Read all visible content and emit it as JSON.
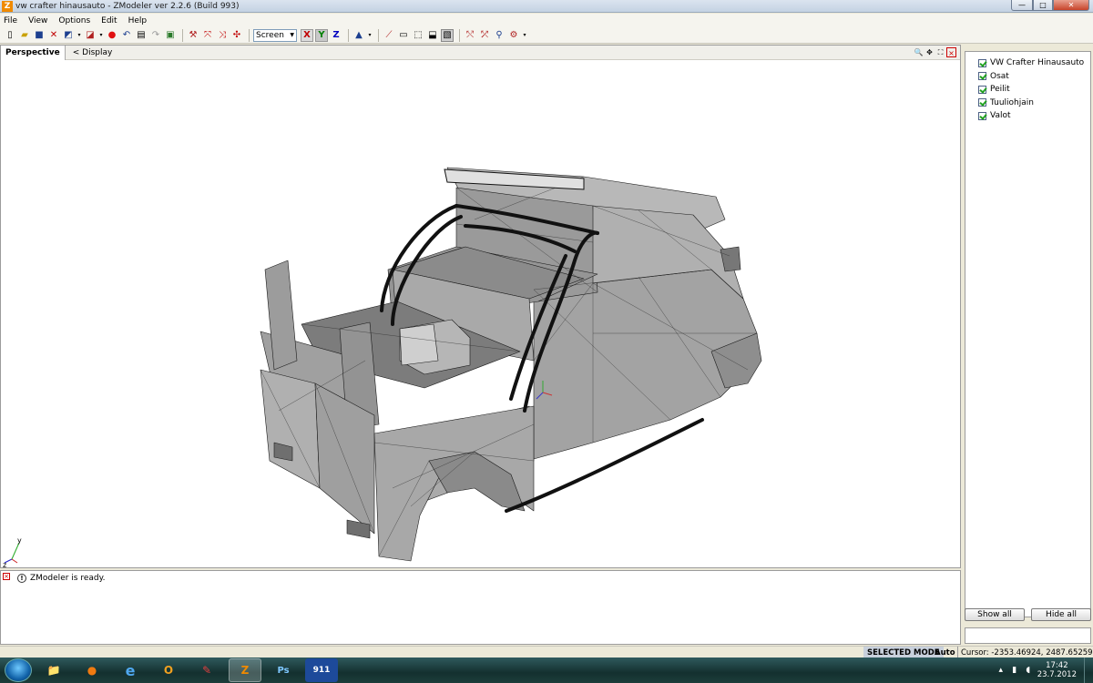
{
  "window": {
    "title": "vw crafter hinausauto - ZModeler ver 2.2.6 (Build 993)",
    "app_icon_letter": "Z",
    "minimize_glyph": "—",
    "maximize_glyph": "□",
    "close_glyph": "✕"
  },
  "menu": [
    "File",
    "View",
    "Options",
    "Edit",
    "Help"
  ],
  "toolbar": {
    "select_value": "Screen",
    "axes": [
      "X",
      "Y",
      "Z"
    ],
    "icons": [
      "new-icon",
      "open-icon",
      "save-icon",
      "delete-icon",
      "import-icon",
      "export-icon",
      "record-icon",
      "undo-icon",
      "properties-icon",
      "render-icon",
      "hierarchy-icon",
      "move-icon",
      "rotate-icon",
      "scale-icon",
      "pointer-icon",
      "pin-icon",
      "frame-icon",
      "box-icon",
      "cube-icon",
      "select-box-icon",
      "wireframe-icon",
      "weld-icon",
      "split-icon",
      "walk-icon",
      "gear-icon"
    ]
  },
  "viewport": {
    "tab": "Perspective",
    "display_label": "<  Display",
    "axis_labels": {
      "y": "y",
      "z": "z"
    }
  },
  "objects": [
    {
      "label": "VW Crafter Hinausauto",
      "checked": true
    },
    {
      "label": "Osat",
      "checked": true
    },
    {
      "label": "Peilit",
      "checked": true
    },
    {
      "label": "Tuuliohjain",
      "checked": true
    },
    {
      "label": "Valot",
      "checked": true
    }
  ],
  "panel": {
    "show_all": "Show all",
    "hide_all": "Hide all"
  },
  "log": {
    "message": "ZModeler is ready.",
    "info_glyph": "!"
  },
  "status": {
    "mode": "SELECTED MODE",
    "auto": "Auto",
    "cursor": "Cursor: -2353.46924, 2487.65259, -383"
  },
  "taskbar": {
    "apps": [
      {
        "name": "explorer",
        "glyph": "📁"
      },
      {
        "name": "firefox",
        "glyph": "●"
      },
      {
        "name": "ie",
        "glyph": "e"
      },
      {
        "name": "outlook",
        "glyph": "O"
      },
      {
        "name": "paint",
        "glyph": "✎"
      },
      {
        "name": "zmodeler",
        "glyph": "Z",
        "active": true
      },
      {
        "name": "photoshop",
        "glyph": "Ps"
      },
      {
        "name": "app911",
        "glyph": "911"
      }
    ],
    "clock_time": "17:42",
    "clock_date": "23.7.2012"
  },
  "colors": {
    "mesh_fill": "#a6a6a6",
    "mesh_dark": "#7c7c7c",
    "mesh_light": "#c4c4c4",
    "edge": "#1a1a1a",
    "zmodeler_accent": "#f08a00"
  }
}
